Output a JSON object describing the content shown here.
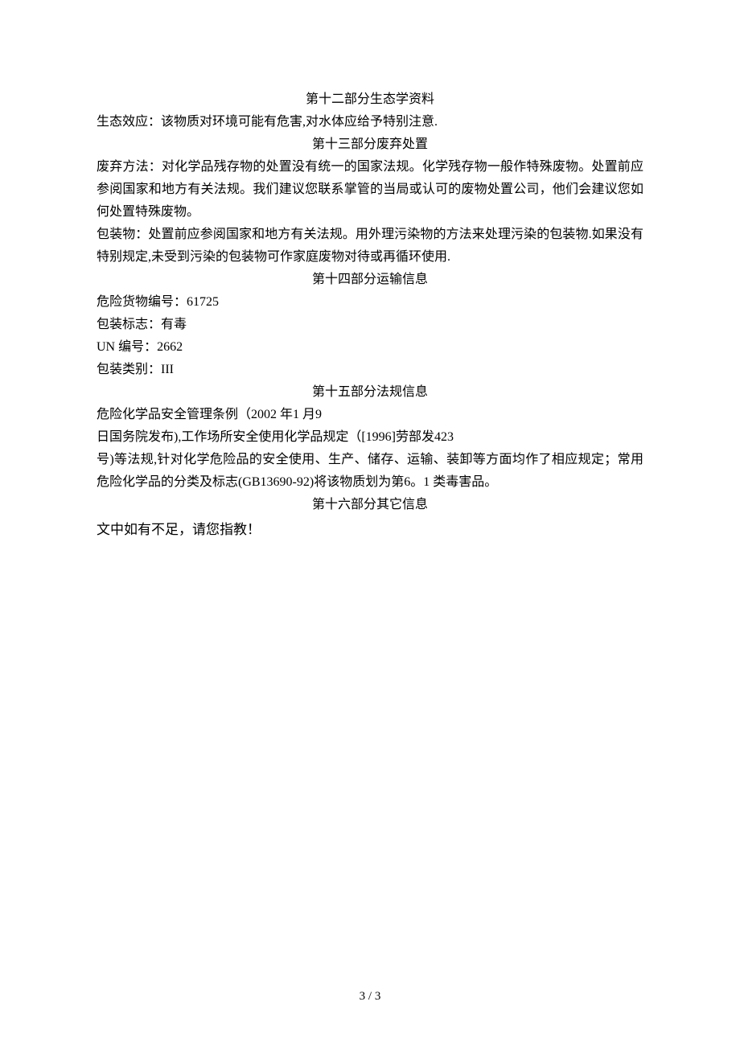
{
  "sections": {
    "s12": {
      "heading": "第十二部分生态学资料",
      "line1": "生态效应：该物质对环境可能有危害,对水体应给予特别注意."
    },
    "s13": {
      "heading": "第十三部分废弃处置",
      "line1": "废弃方法：对化学品残存物的处置没有统一的国家法规。化学残存物一般作特殊废物。处置前应参阅国家和地方有关法规。我们建议您联系掌管的当局或认可的废物处置公司，他们会建议您如何处置特殊废物。",
      "line2": "包装物：处置前应参阅国家和地方有关法规。用外理污染物的方法来处理污染的包装物.如果没有特别规定,未受到污染的包装物可作家庭废物对待或再循环使用."
    },
    "s14": {
      "heading": "第十四部分运输信息",
      "line1": "危险货物编号：61725",
      "line2": "包装标志：有毒",
      "line3": "UN 编号：2662",
      "line4": "包装类别：III"
    },
    "s15": {
      "heading": "第十五部分法规信息",
      "line1": "危险化学品安全管理条例（2002 年1 月9",
      "line2": "日国务院发布),工作场所安全使用化学品规定（[1996]劳部发423",
      "line3": "号)等法规,针对化学危险品的安全使用、生产、储存、运输、装卸等方面均作了相应规定；常用危险化学品的分类及标志(GB13690-92)将该物质划为第6。1 类毒害品。"
    },
    "s16": {
      "heading": "第十六部分其它信息"
    },
    "closing": "文中如有不足，请您指教！",
    "footer": "3 / 3"
  }
}
